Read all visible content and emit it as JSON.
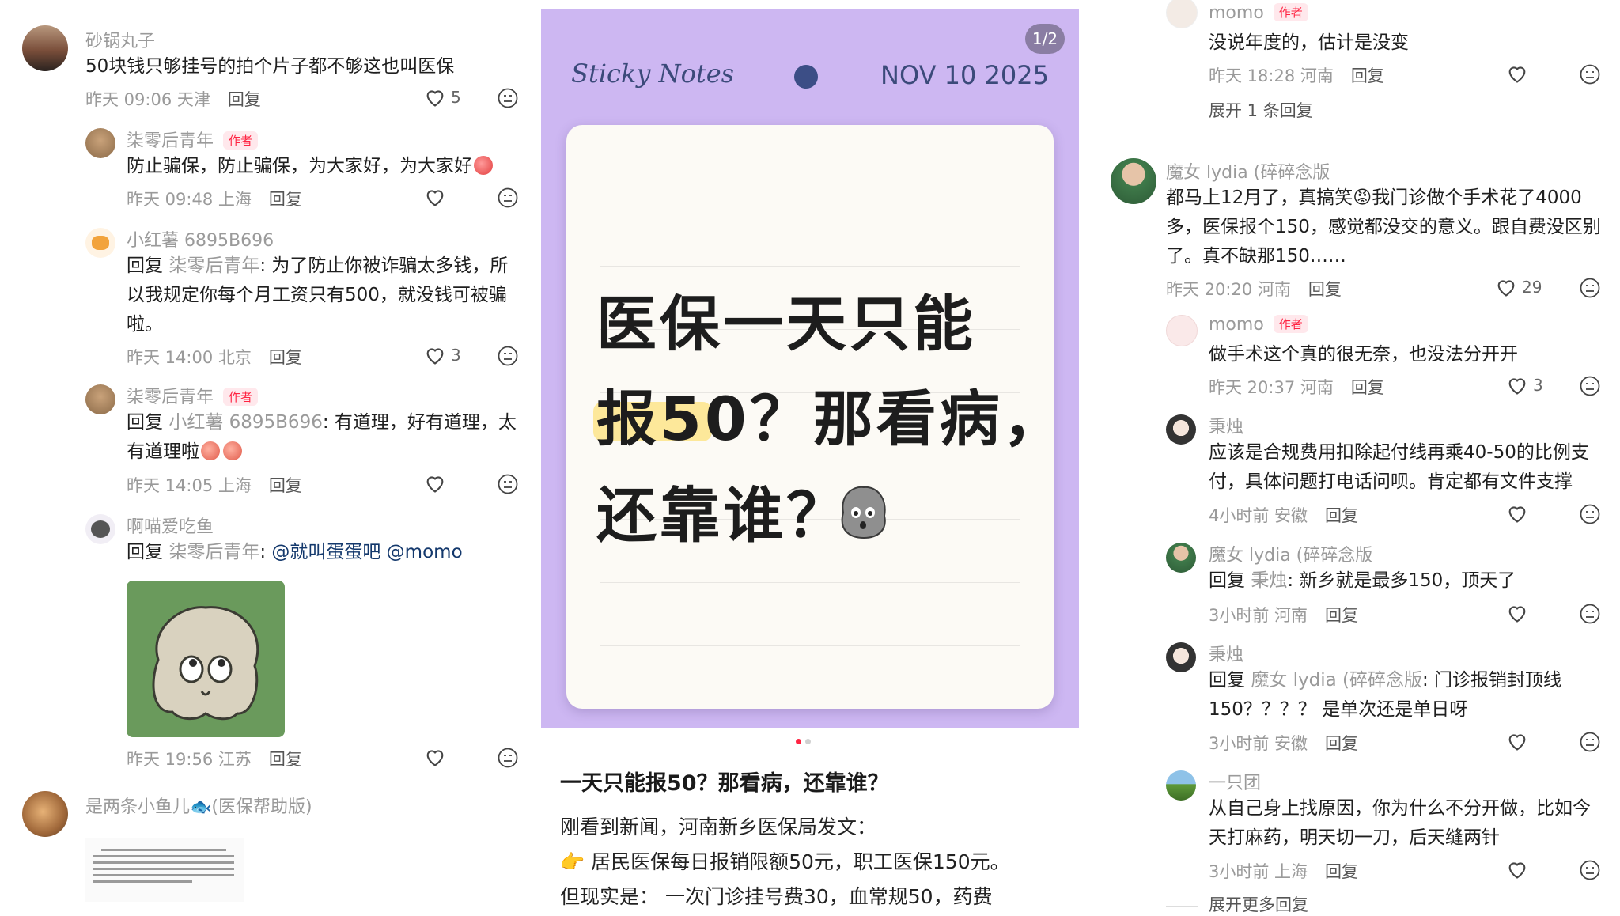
{
  "left": {
    "comments": [
      {
        "name": "砂锅丸子",
        "text": "50块钱只够挂号的拍个片子都不够这也叫医保",
        "time": "昨天 09:06 天津",
        "reply": "回复",
        "likes": "5"
      },
      {
        "name": "柒零后青年",
        "author_tag": "作者",
        "text": "防止骗保，防止骗保，为大家好，为大家好",
        "time": "昨天 09:48 上海",
        "reply": "回复"
      },
      {
        "name": "小红薯 6895B696",
        "reply_prefix": "回复",
        "reply_target": "柒零后青年",
        "text": ": 为了防止你被诈骗太多钱，所以我规定你每个月工资只有500，就没钱可被骗啦。",
        "time": "昨天 14:00 北京",
        "reply": "回复",
        "likes": "3"
      },
      {
        "name": "柒零后青年",
        "author_tag": "作者",
        "reply_prefix": "回复",
        "reply_target": "小红薯 6895B696",
        "text": ": 有道理，好有道理，太有道理啦",
        "time": "昨天 14:05 上海",
        "reply": "回复"
      },
      {
        "name": "啊喵爱吃鱼",
        "reply_prefix": "回复",
        "reply_target": "柒零后青年",
        "text": ": ",
        "mention": "@就叫蛋蛋吧 @momo",
        "time": "昨天 19:56 江苏",
        "reply": "回复"
      },
      {
        "name": "是两条小鱼儿🐟(医保帮助版)"
      }
    ]
  },
  "post": {
    "page_indicator": "1/2",
    "sticky_title": "Sticky Notes",
    "sticky_date": "NOV 10 2025",
    "note_line1": "医保一天只能",
    "note_line2": "报50？那看病，",
    "note_line3": "还靠谁？",
    "title": "一天只能报50？那看病，还靠谁？",
    "line1": "刚看到新闻，河南新乡医保局发文：",
    "line2": "👉 居民医保每日报销限额50元，职工医保150元。",
    "line3": "但现实是： 一次门诊挂号费30，血常规50，药费"
  },
  "right": {
    "comments": [
      {
        "name": "momo",
        "author_tag": "作者",
        "text": "没说年度的，估计是没变",
        "time": "昨天 18:28 河南",
        "reply": "回复"
      },
      {
        "expand": "展开 1 条回复"
      },
      {
        "name": "魔女 lydia (碎碎念版",
        "text": "都马上12月了，真搞笑😡我门诊做个手术花了4000多，医保报个150，感觉都没交的意义。跟自费没区别了。真不缺那150……",
        "time": "昨天 20:20 河南",
        "reply": "回复",
        "likes": "29"
      },
      {
        "name": "momo",
        "author_tag": "作者",
        "text": "做手术这个真的很无奈，也没法分开开",
        "time": "昨天 20:37 河南",
        "reply": "回复",
        "likes": "3"
      },
      {
        "name": "秉烛",
        "text": "应该是合规费用扣除起付线再乘40-50的比例支付，具体问题打电话问呗。肯定都有文件支撑",
        "time": "4小时前 安徽",
        "reply": "回复"
      },
      {
        "name": "魔女 lydia (碎碎念版",
        "reply_prefix": "回复",
        "reply_target": "秉烛",
        "text": ": 新乡就是最多150，顶天了",
        "time": "3小时前 河南",
        "reply": "回复"
      },
      {
        "name": "秉烛",
        "reply_prefix": "回复",
        "reply_target": "魔女 lydia (碎碎念版",
        "text": ": 门诊报销封顶线150？？？？ 是单次还是单日呀",
        "time": "3小时前 安徽",
        "reply": "回复"
      },
      {
        "name": "一只团",
        "text": "从自己身上找原因，你为什么不分开做，比如今天打麻药，明天切一刀，后天缝两针",
        "time": "3小时前 上海",
        "reply": "回复"
      },
      {
        "expand": "展开更多回复"
      }
    ]
  }
}
